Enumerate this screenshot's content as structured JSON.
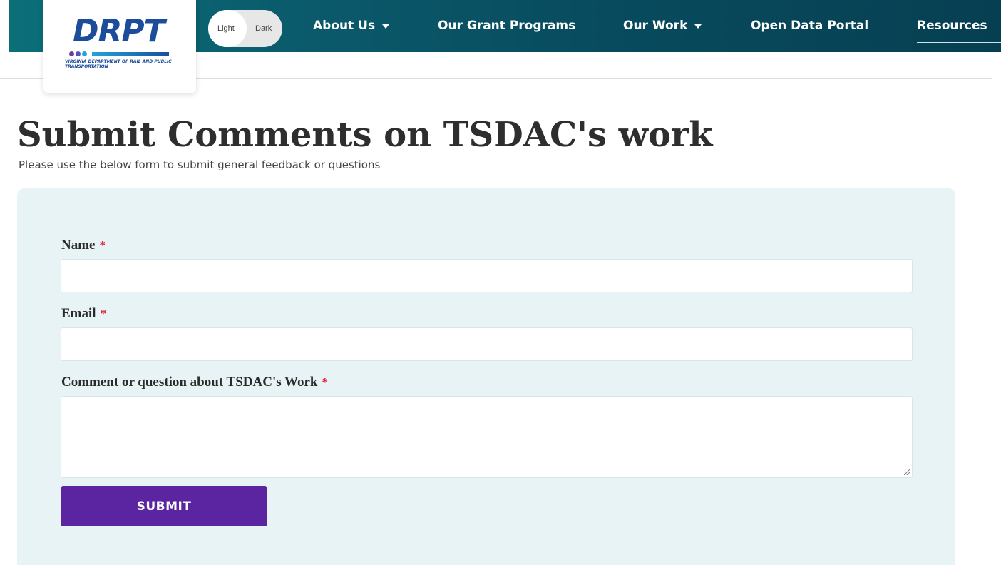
{
  "header": {
    "logo": {
      "wordmark": "DRPT",
      "tagline": "Virginia Department of Rail and Public Transportation",
      "dot_colors": [
        "#6b3aa8",
        "#5a4fbf",
        "#21a5d8"
      ]
    },
    "theme_toggle": {
      "light_label": "Light",
      "dark_label": "Dark",
      "selected": "Light"
    },
    "nav": [
      {
        "label": "About Us",
        "has_dropdown": true
      },
      {
        "label": "Our Grant Programs",
        "has_dropdown": false
      },
      {
        "label": "Our Work",
        "has_dropdown": true
      },
      {
        "label": "Open Data Portal",
        "has_dropdown": false
      },
      {
        "label": "Resources",
        "has_dropdown": false
      }
    ]
  },
  "main": {
    "title": "Submit Comments on TSDAC's work",
    "subtitle": "Please use the below form to submit general feedback or questions",
    "form": {
      "fields": [
        {
          "label": "Name",
          "required_marker": "*",
          "value": ""
        },
        {
          "label": "Email",
          "required_marker": "*",
          "value": ""
        },
        {
          "label": "Comment or question about TSDAC's Work",
          "required_marker": "*",
          "value": ""
        }
      ],
      "submit_label": "SUBMIT"
    }
  },
  "colors": {
    "nav_background": "#0a5a6b",
    "form_background": "#e8f3f5",
    "submit_button": "#5b24a0",
    "required_marker": "#e11d2a",
    "logo_blue": "#1b4d9b"
  }
}
